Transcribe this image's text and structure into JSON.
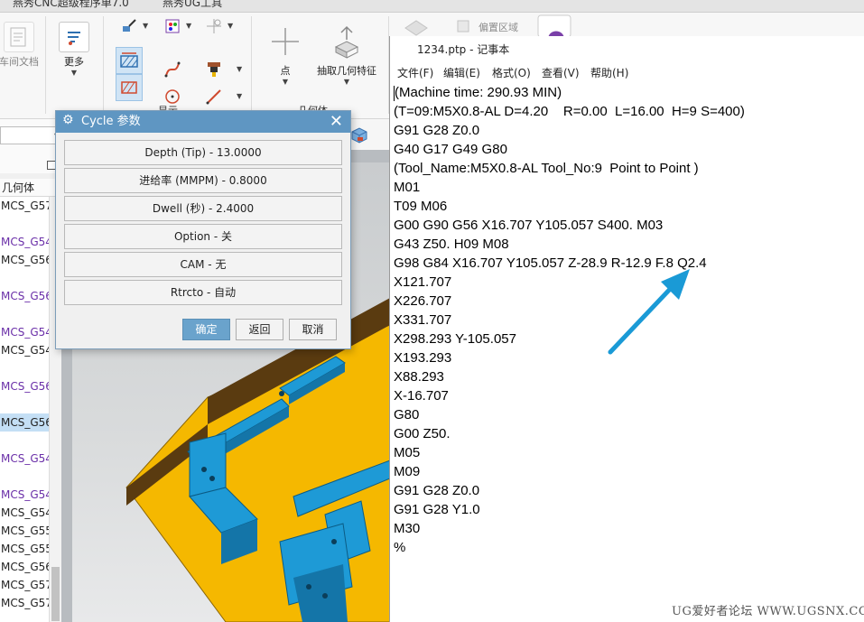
{
  "tabs": [
    "燕秀CNC超级程序单7.0",
    "燕秀UG工具"
  ],
  "ribbon": {
    "left_label": "车间文档",
    "more_label": "更多",
    "display_group_label": "显示",
    "point_label": "点",
    "extract_label": "抽取几何特征",
    "geometry_group_label": "几何体",
    "region_label": "偏置区域"
  },
  "navigator": {
    "header": "几何体",
    "items": [
      {
        "text": "MCS_G57",
        "style": "dark"
      },
      {
        "text": "",
        "style": "dark"
      },
      {
        "text": "MCS_G54",
        "style": "purple"
      },
      {
        "text": "MCS_G56",
        "style": "dark"
      },
      {
        "text": "",
        "style": "dark"
      },
      {
        "text": "MCS_G56",
        "style": "purple"
      },
      {
        "text": "",
        "style": "dark"
      },
      {
        "text": "MCS_G54",
        "style": "purple"
      },
      {
        "text": "MCS_G54",
        "style": "dark"
      },
      {
        "text": "",
        "style": "dark"
      },
      {
        "text": "MCS_G56",
        "style": "purple"
      },
      {
        "text": "",
        "style": "dark"
      },
      {
        "text": "MCS_G56",
        "style": "sel"
      },
      {
        "text": "",
        "style": "dark"
      },
      {
        "text": "MCS_G54",
        "style": "purple"
      },
      {
        "text": "",
        "style": "dark"
      },
      {
        "text": "MCS_G54",
        "style": "purple"
      },
      {
        "text": "MCS_G54",
        "style": "dark"
      },
      {
        "text": "MCS_G55",
        "style": "dark"
      },
      {
        "text": "MCS_G55",
        "style": "dark"
      },
      {
        "text": "MCS_G56",
        "style": "dark"
      },
      {
        "text": "MCS_G57",
        "style": "dark"
      },
      {
        "text": "MCS_G57",
        "style": "dark"
      }
    ]
  },
  "dialog": {
    "title": "Cycle 参数",
    "params": [
      "Depth (Tip) - 13.0000",
      "进给率 (MMPM) - 0.8000",
      "Dwell (秒) - 2.4000",
      "Option - 关",
      "CAM - 无",
      "Rtrcto - 自动"
    ],
    "ok": "确定",
    "back": "返回",
    "cancel": "取消"
  },
  "notepad": {
    "title": "1234.ptp - 记事本",
    "menu": [
      "文件(F)",
      "编辑(E)",
      "格式(O)",
      "查看(V)",
      "帮助(H)"
    ],
    "lines": [
      "(Machine time: 290.93 MIN)",
      "(T=09:M5X0.8-AL D=4.20    R=0.00  L=16.00  H=9 S=400)",
      "G91 G28 Z0.0",
      "G40 G17 G49 G80",
      "(Tool_Name:M5X0.8-AL Tool_No:9  Point to Point )",
      "M01",
      "T09 M06",
      "G00 G90 G56 X16.707 Y105.057 S400. M03",
      "G43 Z50. H09 M08",
      "G98 G84 X16.707 Y105.057 Z-28.9 R-12.9 F.8 Q2.4",
      "X121.707",
      "X226.707",
      "X331.707",
      "X298.293 Y-105.057",
      "X193.293",
      "X88.293",
      "X-16.707",
      "G80",
      "G00 Z50.",
      "M05",
      "M09",
      "G91 G28 Z0.0",
      "G91 G28 Y1.0",
      "M30",
      "%"
    ]
  },
  "watermark": "UG爱好者论坛 WWW.UGSNX.COM",
  "colors": {
    "dialog_title": "#5f96c2",
    "part_yellow": "#f5b800",
    "part_blue": "#1e9ad6",
    "annotation_arrow": "#1a9ad6"
  }
}
